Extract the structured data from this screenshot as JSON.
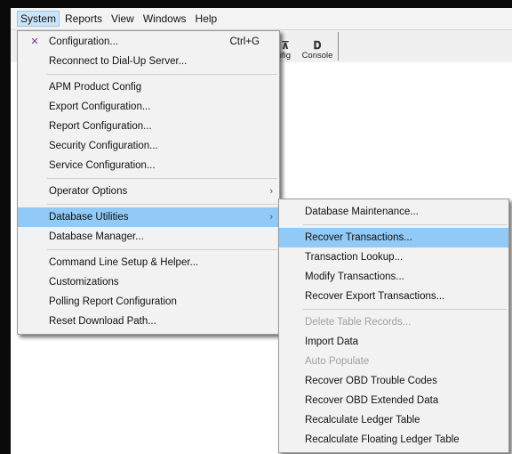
{
  "menubar": {
    "items": [
      {
        "label": "System"
      },
      {
        "label": "Reports"
      },
      {
        "label": "View"
      },
      {
        "label": "Windows"
      },
      {
        "label": "Help"
      }
    ]
  },
  "toolbar": {
    "config_fragment_label": "ifig",
    "console_label": "Console",
    "console_icon": "console-icon",
    "partial_icon": "tool-icon"
  },
  "system_menu": {
    "configuration": {
      "label": "Configuration...",
      "shortcut": "Ctrl+G",
      "icon": "tools-icon"
    },
    "reconnect": {
      "label": "Reconnect to Dial-Up Server..."
    },
    "apm_product_config": {
      "label": "APM Product Config"
    },
    "export_configuration": {
      "label": "Export Configuration..."
    },
    "report_configuration": {
      "label": "Report Configuration..."
    },
    "security_configuration": {
      "label": "Security Configuration..."
    },
    "service_configuration": {
      "label": "Service Configuration..."
    },
    "operator_options": {
      "label": "Operator Options"
    },
    "database_utilities": {
      "label": "Database Utilities"
    },
    "database_manager": {
      "label": "Database Manager..."
    },
    "command_line_setup": {
      "label": "Command Line Setup & Helper..."
    },
    "customizations": {
      "label": "Customizations"
    },
    "polling_report_configuration": {
      "label": "Polling Report Configuration"
    },
    "reset_download_path": {
      "label": "Reset Download Path..."
    }
  },
  "database_utilities_menu": {
    "database_maintenance": {
      "label": "Database Maintenance..."
    },
    "recover_transactions": {
      "label": "Recover Transactions..."
    },
    "transaction_lookup": {
      "label": "Transaction Lookup..."
    },
    "modify_transactions": {
      "label": "Modify Transactions..."
    },
    "recover_export_transactions": {
      "label": "Recover Export Transactions..."
    },
    "delete_table_records": {
      "label": "Delete Table Records...",
      "enabled": false
    },
    "import_data": {
      "label": "Import Data"
    },
    "auto_populate": {
      "label": "Auto Populate",
      "enabled": false
    },
    "recover_obd_trouble_codes": {
      "label": "Recover OBD Trouble Codes"
    },
    "recover_obd_extended_data": {
      "label": "Recover OBD Extended Data"
    },
    "recalculate_ledger_table": {
      "label": "Recalculate Ledger Table"
    },
    "recalculate_floating_ledger_table": {
      "label": "Recalculate Floating Ledger Table"
    }
  },
  "colors": {
    "menu_background": "#f2f2f2",
    "highlight": "#91c9f7",
    "menubar_active": "#cce4f7",
    "disabled_text": "#a0a0a0"
  },
  "glyphs": {
    "submenu_arrow": "›",
    "tools": "✕",
    "console": "𝐃",
    "tool": "⊼"
  }
}
